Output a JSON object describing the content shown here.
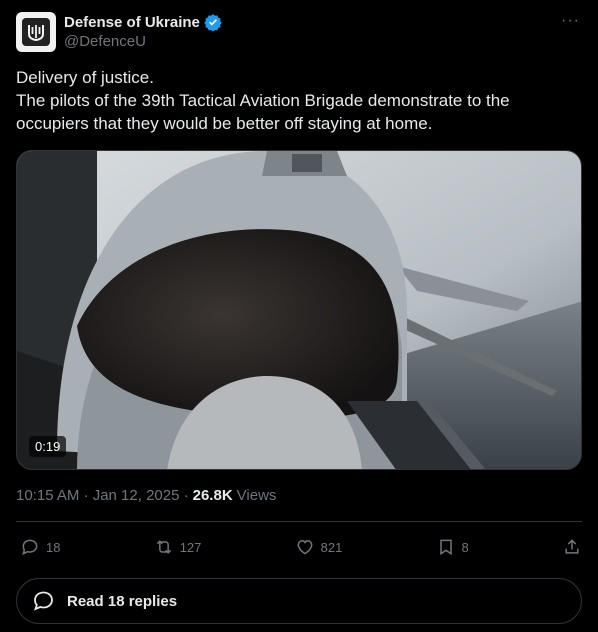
{
  "author": {
    "display_name": "Defense of Ukraine",
    "handle": "@DefenceU",
    "verified": true
  },
  "tweet": {
    "lines": [
      "Delivery of justice.",
      "The pilots of the 39th Tactical Aviation Brigade demonstrate to the occupiers that they would be better off staying at home."
    ]
  },
  "media": {
    "duration": "0:19"
  },
  "meta": {
    "timestamp": "10:15 AM · Jan 12, 2025 ·",
    "views_count": "26.8K",
    "views_label": "Views"
  },
  "actions": {
    "replies": "18",
    "reposts": "127",
    "likes": "821",
    "bookmarks": "8"
  },
  "read_replies": {
    "label": "Read 18 replies"
  },
  "icons": {
    "more": "more-icon",
    "verified": "verified-badge-icon",
    "reply": "reply-icon",
    "repost": "repost-icon",
    "like": "like-icon",
    "bookmark": "bookmark-icon",
    "share": "share-icon",
    "replies": "replies-bubble-icon"
  },
  "colors": {
    "background": "#000000",
    "text": "#e7e9ea",
    "secondary": "#71767b",
    "border": "#2f3336",
    "verified": "#1d9bf0"
  }
}
